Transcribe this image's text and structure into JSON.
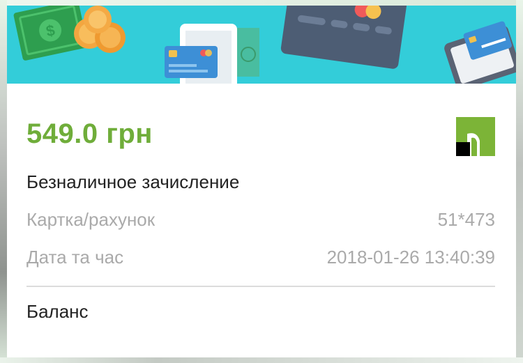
{
  "transaction": {
    "amount": "549.0 грн",
    "description": "Безналичное зачисление",
    "card_label": "Картка/рахунок",
    "card_value": "51*473",
    "datetime_label": "Дата та час",
    "datetime_value": "2018-01-26 13:40:39",
    "balance_label": "Баланс"
  },
  "colors": {
    "accent_green": "#6fad3a",
    "banner_bg": "#33cdd9"
  },
  "icons": {
    "banner": [
      "cash-bill-icon",
      "coins-icon",
      "smartphone-icon",
      "bank-card-icon",
      "wallet-icon",
      "card-reader-icon"
    ],
    "logo": "bank-logo-icon"
  }
}
